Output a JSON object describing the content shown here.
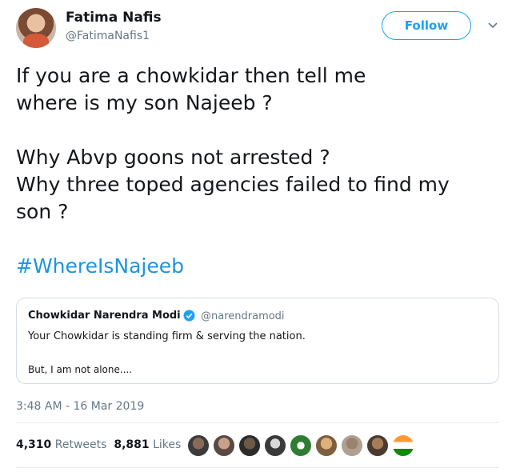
{
  "author": {
    "name": "Fatima Nafis",
    "handle": "@FatimaNafis1",
    "follow_label": "Follow"
  },
  "tweet": {
    "paragraphs": [
      [
        "If you are a chowkidar then tell me",
        "where is my son Najeeb ?"
      ],
      [
        "Why Abvp goons not arrested ?",
        "Why three toped agencies failed to find my",
        "son ?"
      ]
    ],
    "hashtag": "#WhereIsNajeeb"
  },
  "quoted": {
    "name": "Chowkidar Narendra Modi",
    "handle": "@narendramodi",
    "line1": "Your Chowkidar is standing firm & serving the nation.",
    "line2": "But, I am not alone...."
  },
  "timestamp": "3:48 AM - 16 Mar 2019",
  "stats": {
    "retweets_count": "4,310",
    "retweets_label": "Retweets",
    "likes_count": "8,881",
    "likes_label": "Likes"
  },
  "icons": {
    "verified": "verified-badge-icon",
    "chevron": "chevron-down-icon"
  },
  "colors": {
    "accent": "#1da1f2",
    "hashtag": "#1b95e0",
    "muted": "#657786"
  }
}
